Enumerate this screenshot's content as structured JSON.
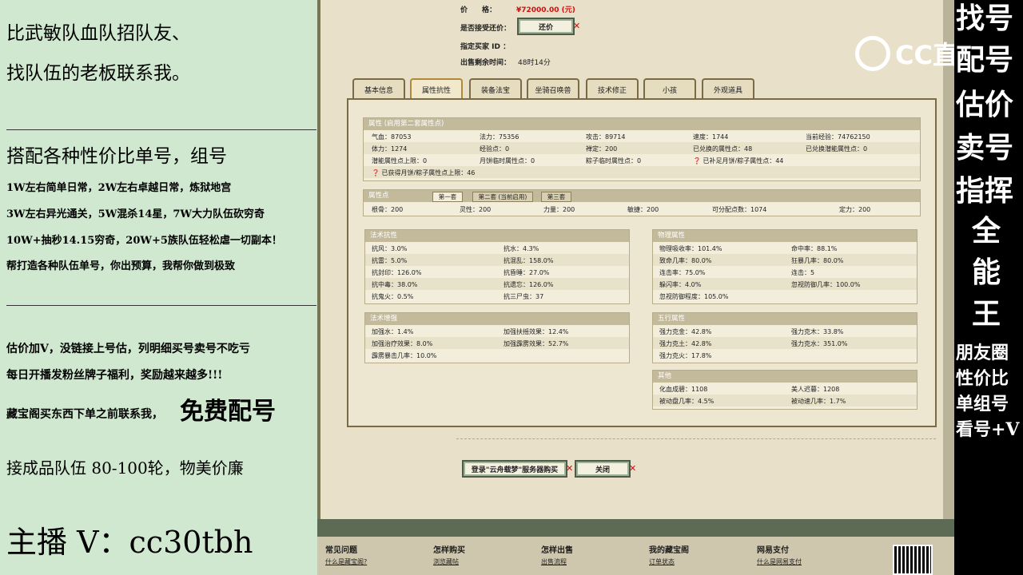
{
  "left_panel": {
    "line1": "比武敏队血队招队友、",
    "line2": "找队伍的老板联系我。",
    "line3": "搭配各种性价比单号，组号",
    "line4": "1W左右简单日常，2W左右卓越日常，炼狱地宫",
    "line5": "3W左右异光通关，5W混杀14星，7W大力队伍砍穷奇",
    "line6": "10W+抽秒14.15穷奇，20W+5族队伍轻松虐一切副本！",
    "line7": "帮打造各种队伍单号，你出预算，我帮你做到极致",
    "line8": "估价加V，没链接上号估，列明细买号卖号不吃亏",
    "line9": "每日开播发粉丝牌子福利，奖励越来越多!!!",
    "line10a": "藏宝阁买东西下单之前联系我，",
    "line10b": "免费配号",
    "line11": "接成品队伍 80-100轮，物美价廉",
    "line12": "主播 V：cc30tbh"
  },
  "header_info": {
    "price_label": "价　　格：",
    "price_value": "¥72000.00 (元)",
    "counter_label": "是否接受还价：",
    "counter_button": "还价",
    "buyer_label": "指定买家 ID ：",
    "time_label": "出售剩余时间：",
    "time_value": "48时14分"
  },
  "tabs": [
    "基本信息",
    "属性抗性",
    "装备法宝",
    "坐骑召唤兽",
    "技术修正",
    "小孩",
    "外观道具"
  ],
  "attr": {
    "head": "属性 (启用第二套属性点)",
    "r1": [
      "气血：87053",
      "法力：75356",
      "攻击：89714",
      "速度：1744",
      "当前经验：74762150"
    ],
    "r2": [
      "体力：1274",
      "经验点：0",
      "禅定：200",
      "已兑换的属性点：48",
      "已兑换潜能属性点：0"
    ],
    "r3": [
      "潜能属性点上限：0",
      "月饼临时属性点：0",
      "粽子临时属性点：0",
      "已补足月饼/粽子属性点：44"
    ],
    "r4": "已获得月饼/粽子属性点上限：46"
  },
  "points": {
    "head": "属性点",
    "subtabs": [
      "第一套",
      "第二套 (当前启用)",
      "第三套"
    ],
    "row": [
      "根骨：200",
      "灵性：200",
      "力量：200",
      "敏捷：200",
      "可分配点数：1074",
      "定力：200"
    ]
  },
  "resist": {
    "head": "法术抗性",
    "rows": [
      [
        "抗风：3.0%",
        "抗水：4.3%"
      ],
      [
        "抗雷：5.0%",
        "抗混乱：158.0%"
      ],
      [
        "抗封印：126.0%",
        "抗昏睡：27.0%"
      ],
      [
        "抗中毒：38.0%",
        "抗遗忘：126.0%"
      ],
      [
        "抗鬼火：0.5%",
        "抗三尸虫：37"
      ]
    ]
  },
  "physical": {
    "head": "物理属性",
    "rows": [
      [
        "物理吸收率：101.4%",
        "命中率：88.1%"
      ],
      [
        "致命几率：80.0%",
        "狂暴几率：80.0%"
      ],
      [
        "连击率：75.0%",
        "连击：5"
      ],
      [
        "躲闪率：4.0%",
        "忽视防御几率：100.0%"
      ],
      [
        "忽视防御程度：105.0%",
        ""
      ]
    ]
  },
  "boost": {
    "head": "法术增强",
    "rows": [
      [
        "加强水：1.4%",
        "加强扶摇效果：12.4%"
      ],
      [
        "加强治疗效果：8.0%",
        "加强霹雳效果：52.7%"
      ],
      [
        "霹雳暴击几率：10.0%",
        ""
      ]
    ]
  },
  "wuxing": {
    "head": "五行属性",
    "rows": [
      [
        "强力克金：42.8%",
        "强力克木：33.8%"
      ],
      [
        "强力克土：42.8%",
        "强力克水：351.0%"
      ],
      [
        "强力克火：17.8%",
        ""
      ]
    ]
  },
  "other": {
    "head": "其他",
    "rows": [
      [
        "化血成碧：1108",
        "美人迟暮：1208"
      ],
      [
        "被动盘几率：4.5%",
        "被动速几率：1.7%"
      ]
    ]
  },
  "bottom_buttons": {
    "login": "登录\"云舟载梦\"服务器购买",
    "close": "关闭"
  },
  "footer": {
    "heads": [
      "常见问题",
      "怎样购买",
      "怎样出售",
      "我的藏宝阁",
      "网易支付"
    ],
    "links": [
      "什么是藏宝阁?",
      "浏览藏帖",
      "出售流程",
      "订单状态",
      "什么是网易支付"
    ]
  },
  "right_strip": {
    "vertical": [
      "找号",
      "配号",
      "估价",
      "卖号",
      "指挥",
      "全",
      "能",
      "王"
    ],
    "tail": [
      "朋友圈",
      "性价比",
      "单组号",
      "看号+V"
    ]
  },
  "logo_text": "CC直播"
}
